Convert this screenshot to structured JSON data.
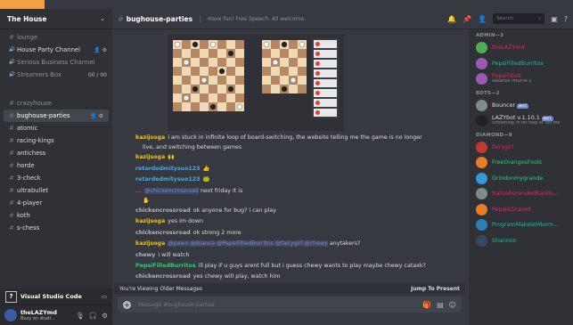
{
  "server": {
    "name": "The House"
  },
  "channels": [
    {
      "name": "lounge",
      "kind": "text",
      "bright": false
    },
    {
      "name": "House Party Channel",
      "kind": "voice",
      "bright": true,
      "trail": "👤 ⚙"
    },
    {
      "name": "Serious Business Channel",
      "kind": "voice",
      "bright": false
    },
    {
      "name": "Streamers Box",
      "kind": "voice",
      "bright": false,
      "trail": "00 / 00"
    },
    {
      "gap": true
    },
    {
      "name": "crazyhouse",
      "kind": "text",
      "bright": false
    },
    {
      "name": "bughouse-parties",
      "kind": "text",
      "bright": true,
      "selected": true,
      "trail": "👤 ⚙"
    },
    {
      "name": "atomic",
      "kind": "text",
      "bright": true
    },
    {
      "name": "racing-kings",
      "kind": "text",
      "bright": true
    },
    {
      "name": "antichess",
      "kind": "text",
      "bright": true
    },
    {
      "name": "horde",
      "kind": "text",
      "bright": true
    },
    {
      "name": "3-check",
      "kind": "text",
      "bright": true
    },
    {
      "name": "ultrabullet",
      "kind": "text",
      "bright": true
    },
    {
      "name": "4-player",
      "kind": "text",
      "bright": true
    },
    {
      "name": "koth",
      "kind": "text",
      "bright": true
    },
    {
      "name": "s-chess",
      "kind": "text",
      "bright": true
    }
  ],
  "activity": {
    "label": "Visual Studio Code"
  },
  "user": {
    "name": "theLAZYmd",
    "status": "Busy on studi..."
  },
  "header": {
    "channel": "bughouse-parties",
    "topic": "Have fun! Free Speech. All welcome.",
    "search_placeholder": "Search"
  },
  "messages": [
    {
      "author": "kazijsoga",
      "color": "yellow",
      "text": "i am stuck in infinite loop of board-switching, the website telling me the game is no longer"
    },
    {
      "cont": true,
      "text": "live, and switching between games"
    },
    {
      "author": "kazijsoga",
      "color": "yellow",
      "text": "🙌"
    },
    {
      "author": "retardedmitysuo123",
      "color": "blue",
      "text": "👍"
    },
    {
      "author": "retardedmitysuo123",
      "color": "blue",
      "text": "🐸"
    },
    {
      "author": "...",
      "color": "red",
      "mention": "@chickencrossroad",
      "text": "next friday it is"
    },
    {
      "cont": true,
      "text": "✋"
    },
    {
      "author": "chickencrossroad",
      "color": "gray",
      "text": "ok anyone for bug? i can play"
    },
    {
      "author": "kazijsoga",
      "color": "yellow",
      "text": "yes im down"
    },
    {
      "author": "chickencrossroad",
      "color": "gray",
      "text": "ok strong 2 more"
    },
    {
      "author": "kazijsoga",
      "color": "yellow",
      "mention": "@pawn @Bianca @PepsiFilledBurritos @fairygirl @chewy",
      "text": "anytakers?"
    },
    {
      "author": "chewy",
      "color": "gray",
      "text": "i will watch"
    },
    {
      "author": "PepsiFilledBurritos",
      "color": "green",
      "text": "ill play if u guys arent full but i guess chewy wants to play maybe chewy cataxk?"
    },
    {
      "author": "chickencrossroad",
      "color": "gray",
      "text": "yes chewy will play, watch him"
    }
  ],
  "older_bar": {
    "label": "You're Viewing Older Messages",
    "jump": "Jump To Present"
  },
  "composer": {
    "placeholder": "Message #bughouse-parties"
  },
  "member_groups": [
    {
      "role": "ADMIN—3",
      "members": [
        {
          "name": "theLAZYmd",
          "color": "#e91e63",
          "av": "#4caf50"
        },
        {
          "name": "PepsiFilledBurritos",
          "color": "#1abc9c",
          "av": "#9b59b6"
        },
        {
          "name": "PepsiFilled",
          "color": "#e91e63",
          "av": "#9b59b6",
          "sub": "Vacation Income 2"
        }
      ]
    },
    {
      "role": "BOTS—2",
      "members": [
        {
          "name": "Bouncer",
          "color": "#dcddde",
          "av": "#7f8c8d",
          "bot": "BOT"
        },
        {
          "name": "LAZYbot v.1.10.1",
          "color": "#dcddde",
          "av": "#202225",
          "bot": "BOT",
          "sub": "Streaming !h for help or !bh me"
        }
      ]
    },
    {
      "role": "DIAMOND—9",
      "members": [
        {
          "name": "fairygirl",
          "color": "#e91e63",
          "av": "#c0392b"
        },
        {
          "name": "FreeOrangesFools",
          "color": "#2ecc71",
          "av": "#e67e22"
        },
        {
          "name": "Grindonmygrande",
          "color": "#2ecc71",
          "av": "#3498db"
        },
        {
          "name": "NatsoAscendedRando...",
          "color": "#e91e63",
          "av": "#7f8c8d"
        },
        {
          "name": "PepsiisScared",
          "color": "#e91e63",
          "av": "#e67e22"
        },
        {
          "name": "ProgramMakeleMbem...",
          "color": "#1abc9c",
          "av": "#2980b9"
        },
        {
          "name": "Shannon",
          "color": "#1abc9c",
          "av": "#34495e"
        }
      ]
    }
  ]
}
